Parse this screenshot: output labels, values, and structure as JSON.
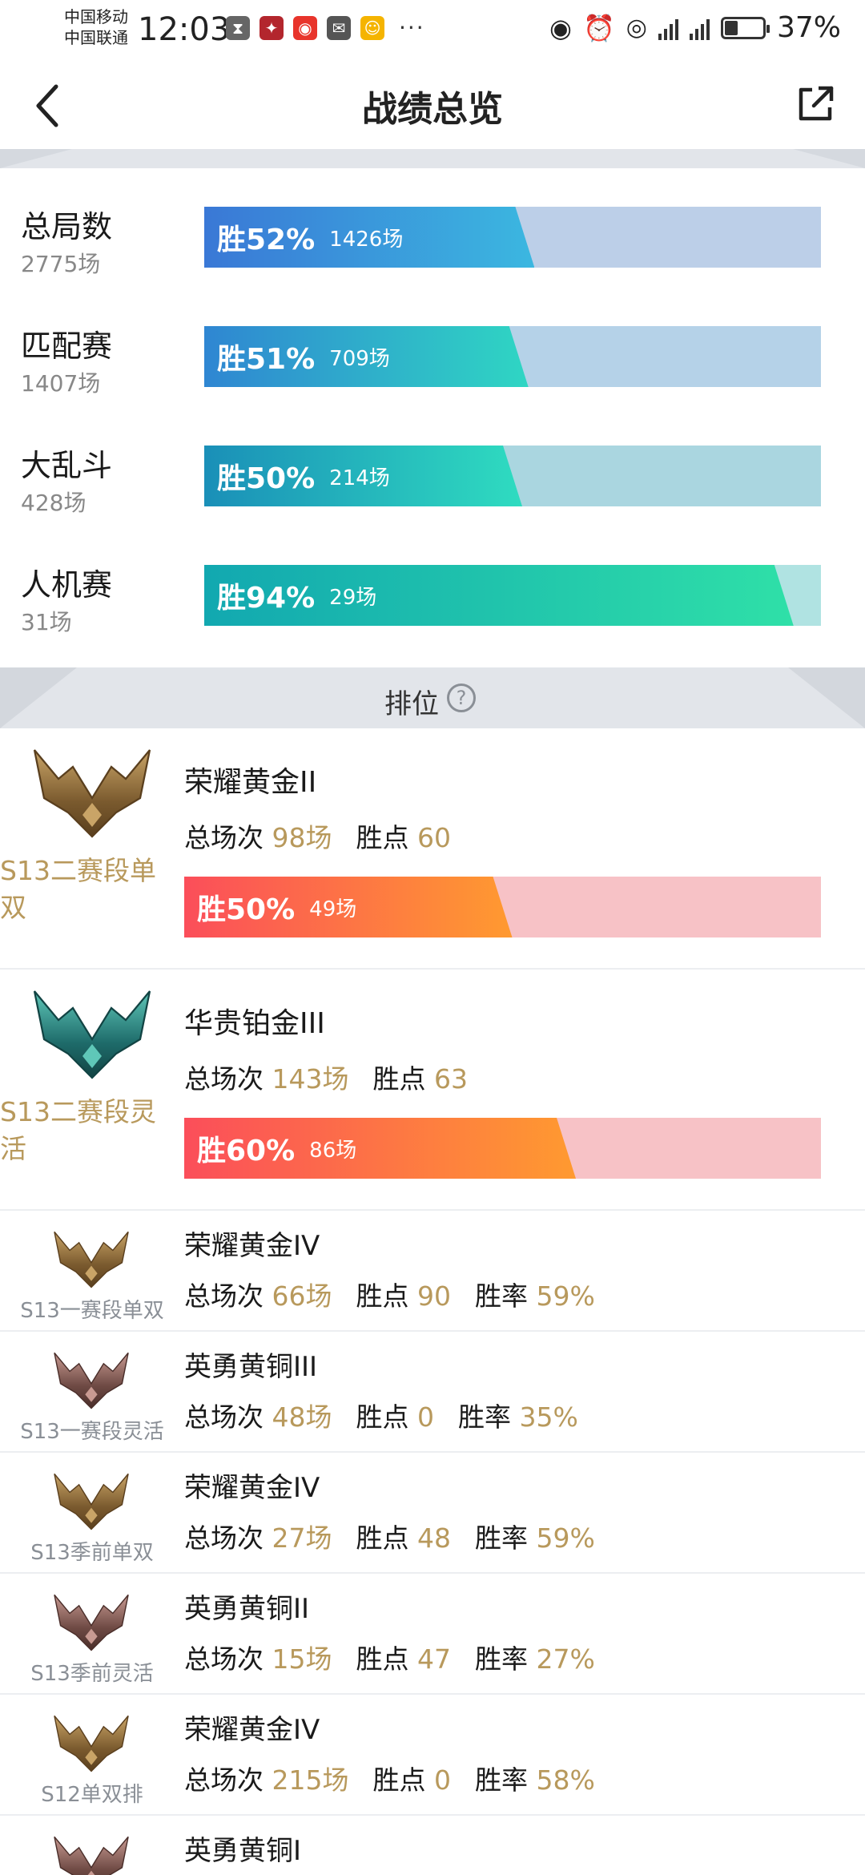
{
  "status_bar": {
    "carrier_1": "中国移动",
    "carrier_2": "中国联通",
    "time": "12:03",
    "battery": "37%"
  },
  "header": {
    "title": "战绩总览"
  },
  "summary": [
    {
      "name": "总局数",
      "count": "2775场",
      "pct": "胜52%",
      "games": "1426场",
      "fill": 0.52,
      "color_from": "#3a78d6",
      "color_to": "#3bb7e0",
      "track": "#bccfe8"
    },
    {
      "name": "匹配赛",
      "count": "1407场",
      "pct": "胜51%",
      "games": "709场",
      "fill": 0.51,
      "color_from": "#2f86d2",
      "color_to": "#2fd6c3",
      "track": "#b5d2e8"
    },
    {
      "name": "大乱斗",
      "count": "428场",
      "pct": "胜50%",
      "games": "214场",
      "fill": 0.5,
      "color_from": "#1a8fb8",
      "color_to": "#2fdcc0",
      "track": "#aad6e0"
    },
    {
      "name": "人机赛",
      "count": "31场",
      "pct": "胜94%",
      "games": "29场",
      "fill": 0.94,
      "color_from": "#12a8b0",
      "color_to": "#2fe0a8",
      "track": "#b0e3e2"
    }
  ],
  "rank_section": {
    "title": "排位",
    "help": "?"
  },
  "ranks_large": [
    {
      "tier": "荣耀黄金II",
      "season": "S13二赛段单双",
      "total_label": "总场次",
      "total": "98场",
      "points_label": "胜点",
      "points": "60",
      "pct": "胜50%",
      "games": "49场",
      "fill": 0.5,
      "emblem": "gold"
    },
    {
      "tier": "华贵铂金III",
      "season": "S13二赛段灵活",
      "total_label": "总场次",
      "total": "143场",
      "points_label": "胜点",
      "points": "63",
      "pct": "胜60%",
      "games": "86场",
      "fill": 0.6,
      "emblem": "platinum"
    }
  ],
  "ranks_small": [
    {
      "tier": "荣耀黄金IV",
      "season": "S13一赛段单双",
      "total_label": "总场次",
      "total": "66场",
      "points_label": "胜点",
      "points": "90",
      "rate_label": "胜率",
      "rate": "59%",
      "emblem": "gold"
    },
    {
      "tier": "英勇黄铜III",
      "season": "S13一赛段灵活",
      "total_label": "总场次",
      "total": "48场",
      "points_label": "胜点",
      "points": "0",
      "rate_label": "胜率",
      "rate": "35%",
      "emblem": "bronze"
    },
    {
      "tier": "荣耀黄金IV",
      "season": "S13季前单双",
      "total_label": "总场次",
      "total": "27场",
      "points_label": "胜点",
      "points": "48",
      "rate_label": "胜率",
      "rate": "59%",
      "emblem": "gold"
    },
    {
      "tier": "英勇黄铜II",
      "season": "S13季前灵活",
      "total_label": "总场次",
      "total": "15场",
      "points_label": "胜点",
      "points": "47",
      "rate_label": "胜率",
      "rate": "27%",
      "emblem": "bronze"
    },
    {
      "tier": "荣耀黄金IV",
      "season": "S12单双排",
      "total_label": "总场次",
      "total": "215场",
      "points_label": "胜点",
      "points": "0",
      "rate_label": "胜率",
      "rate": "58%",
      "emblem": "gold"
    },
    {
      "tier": "英勇黄铜I",
      "season": "",
      "total_label": "",
      "total": "",
      "points_label": "",
      "points": "",
      "rate_label": "",
      "rate": "",
      "emblem": "bronze"
    }
  ],
  "colors": {
    "gold_text": "#b8995c",
    "rank_bar_from": "#fb4e5a",
    "rank_bar_to": "#ff9a30",
    "rank_track": "#f7c2c6"
  }
}
